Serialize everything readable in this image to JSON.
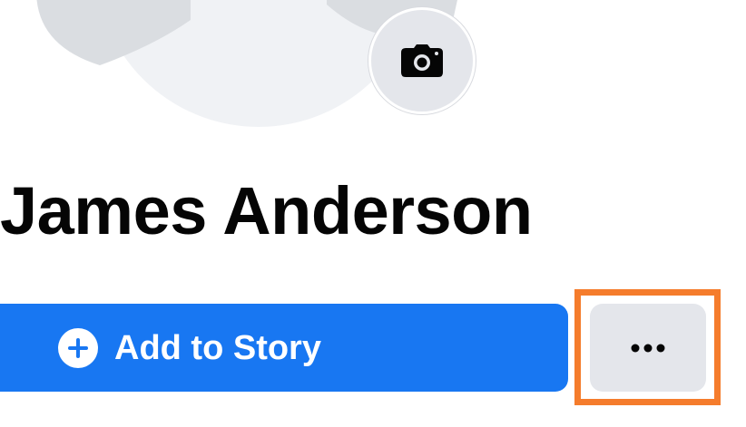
{
  "profile": {
    "name": "James Anderson"
  },
  "actions": {
    "add_to_story_label": "Add to Story",
    "more_icon": "more-horizontal-icon",
    "camera_icon": "camera-icon",
    "plus_icon": "plus-circle-icon"
  },
  "colors": {
    "primary_blue": "#1877f2",
    "secondary_gray": "#e4e6eb",
    "highlight_orange": "#f57c2c",
    "avatar_placeholder": "#dadde1",
    "avatar_bg": "#f0f2f5",
    "text_primary": "#050505"
  }
}
